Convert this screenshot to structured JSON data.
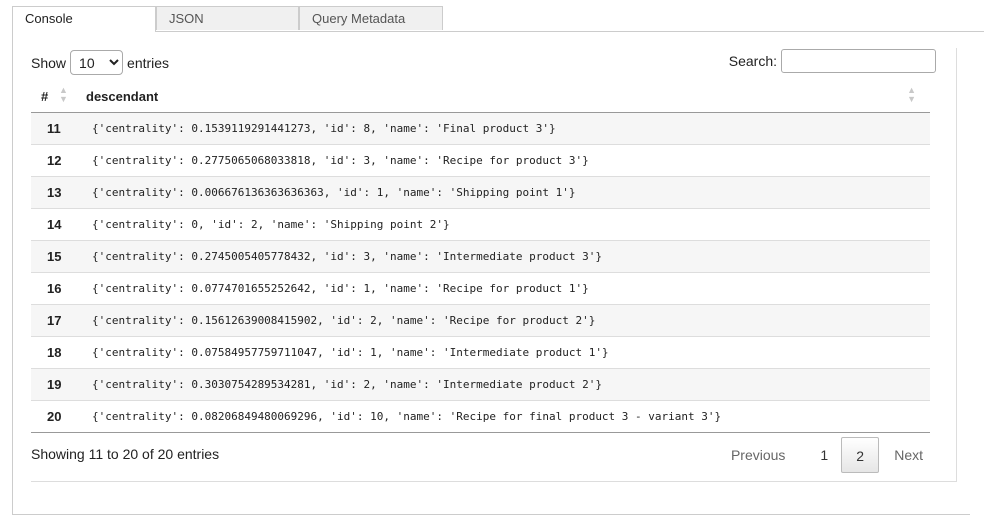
{
  "tabs": [
    "Console",
    "JSON",
    "Query Metadata"
  ],
  "controls": {
    "show_label": "Show",
    "entries_label": "entries",
    "page_size": "10",
    "search_label": "Search:",
    "search_value": ""
  },
  "table": {
    "headers": [
      "#",
      "descendant"
    ],
    "rows": [
      [
        "11",
        "{'centrality': 0.1539119291441273, 'id': 8, 'name': 'Final product 3'}"
      ],
      [
        "12",
        "{'centrality': 0.2775065068033818, 'id': 3, 'name': 'Recipe for product 3'}"
      ],
      [
        "13",
        "{'centrality': 0.006676136363636363, 'id': 1, 'name': 'Shipping point 1'}"
      ],
      [
        "14",
        "{'centrality': 0, 'id': 2, 'name': 'Shipping point 2'}"
      ],
      [
        "15",
        "{'centrality': 0.2745005405778432, 'id': 3, 'name': 'Intermediate product 3'}"
      ],
      [
        "16",
        "{'centrality': 0.0774701655252642, 'id': 1, 'name': 'Recipe for product 1'}"
      ],
      [
        "17",
        "{'centrality': 0.15612639008415902, 'id': 2, 'name': 'Recipe for product 2'}"
      ],
      [
        "18",
        "{'centrality': 0.07584957759711047, 'id': 1, 'name': 'Intermediate product 1'}"
      ],
      [
        "19",
        "{'centrality': 0.3030754289534281, 'id': 2, 'name': 'Intermediate product 2'}"
      ],
      [
        "20",
        "{'centrality': 0.08206849480069296, 'id': 10, 'name': 'Recipe for final product 3 - variant 3'}"
      ]
    ]
  },
  "footer": {
    "info": "Showing 11 to 20 of 20 entries",
    "previous": "Previous",
    "pages": [
      "1",
      "2"
    ],
    "current_page": "2",
    "next": "Next"
  }
}
